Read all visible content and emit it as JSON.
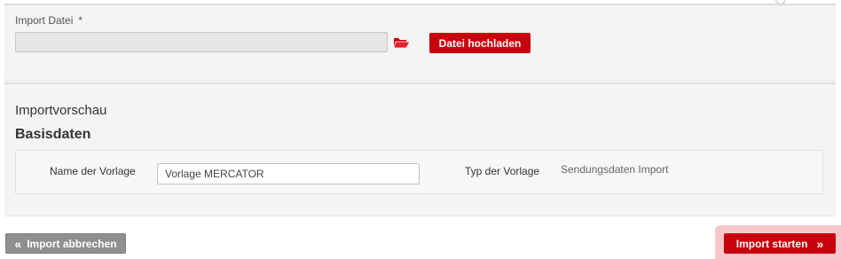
{
  "upload": {
    "label": "Import Datei",
    "required_marker": "*",
    "file_value": "",
    "upload_button": "Datei hochladen",
    "folder_icon": "folder-open-icon",
    "icon_color": "#c8020c"
  },
  "preview": {
    "title": "Importvorschau",
    "section_title": "Basisdaten",
    "name_label": "Name der Vorlage",
    "name_value": "Vorlage MERCATOR",
    "type_label": "Typ der Vorlage",
    "type_value": "Sendungsdaten Import"
  },
  "footer": {
    "cancel_button": "Import abbrechen",
    "cancel_icon": "double-chevron-left-icon",
    "start_button": "Import starten",
    "start_icon": "double-chevron-right-icon"
  },
  "colors": {
    "accent": "#c8020c",
    "secondary_button": "#8f8f8f",
    "panel_background": "#f4f4f4",
    "highlight": "#f6c7cb"
  }
}
